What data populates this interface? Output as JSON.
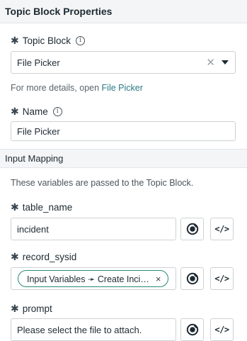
{
  "properties": {
    "header": "Topic Block Properties",
    "topic_block_label": "Topic Block",
    "topic_block_value": "File Picker",
    "details_prefix": "For more details, open ",
    "details_link": "File Picker",
    "name_label": "Name",
    "name_value": "File Picker"
  },
  "mapping": {
    "header": "Input Mapping",
    "description": "These variables are passed to the Topic Block.",
    "fields": [
      {
        "label": "table_name",
        "value": "incident"
      },
      {
        "label": "record_sysid",
        "pill": "Input Variables ➛ Create Inci…",
        "pill_remove": "×"
      },
      {
        "label": "prompt",
        "value": "Please select the file to attach."
      }
    ],
    "code_button_label": "</>"
  },
  "icons": {
    "required": "asterisk-icon",
    "info": "info-icon",
    "clear": "clear-x-icon",
    "caret": "dropdown-caret-icon",
    "data_pill": "data-pill-picker-icon",
    "script": "script-code-icon"
  },
  "colors": {
    "link": "#2a7a86",
    "pill_border": "#2a8a76",
    "header_bg": "#f4f5f6"
  }
}
